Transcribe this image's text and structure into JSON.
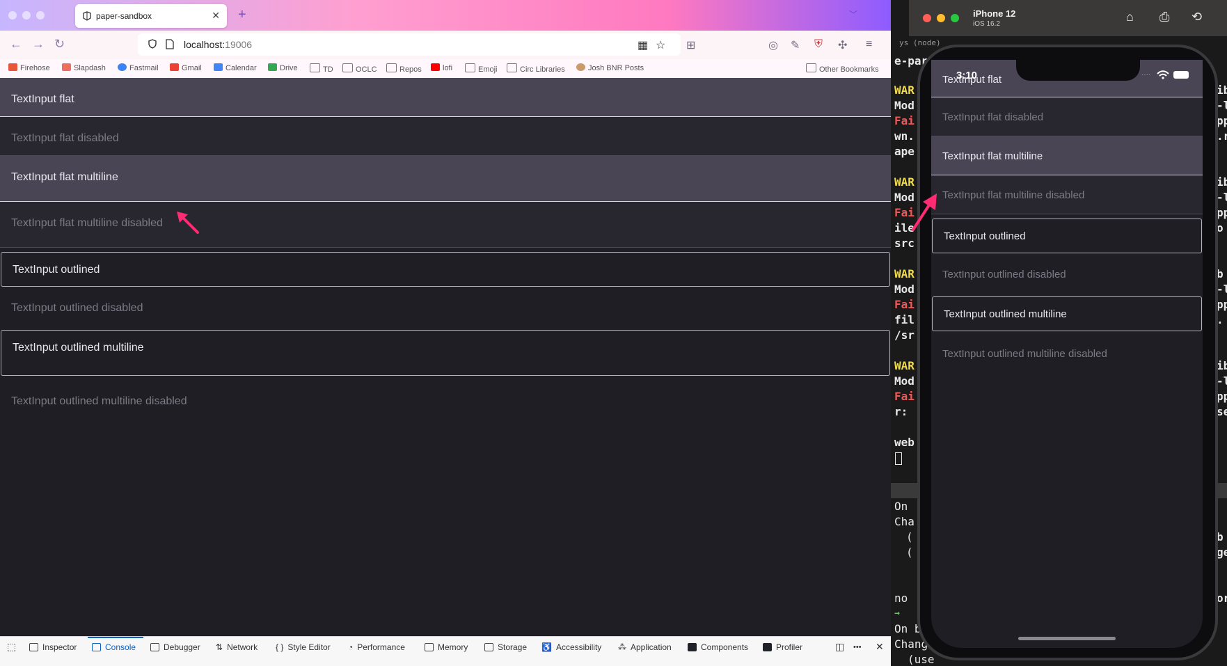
{
  "browser": {
    "tab_title": "paper-sandbox",
    "tab_close": "✕",
    "new_tab": "+",
    "url_host": "localhost:",
    "url_port": "19006",
    "bookmarks": [
      {
        "label": "Firehose",
        "color": "#e8563c"
      },
      {
        "label": "Slapdash",
        "color": "#ee6e5d"
      },
      {
        "label": "Fastmail",
        "color": "#3b83f6"
      },
      {
        "label": "Gmail",
        "color": "#ea4335"
      },
      {
        "label": "Calendar",
        "color": "#4285f4"
      },
      {
        "label": "Drive",
        "color": "#34a853"
      },
      {
        "label": "TD",
        "color": "folder"
      },
      {
        "label": "OCLC",
        "color": "folder"
      },
      {
        "label": "Repos",
        "color": "folder"
      },
      {
        "label": "lofi",
        "color": "#ff0000"
      },
      {
        "label": "Emoji",
        "color": "folder"
      },
      {
        "label": "Circ Libraries",
        "color": "folder"
      },
      {
        "label": "Josh BNR Posts",
        "color": "#c99a6a"
      }
    ],
    "other_bookmarks": "Other Bookmarks"
  },
  "web_inputs": [
    {
      "label": "TextInput flat",
      "variant": "flat",
      "disabled": false
    },
    {
      "label": "TextInput flat disabled",
      "variant": "flat",
      "disabled": true
    },
    {
      "label": "TextInput flat multiline",
      "variant": "flat",
      "disabled": false
    },
    {
      "label": "TextInput flat multiline disabled",
      "variant": "flat",
      "disabled": true
    },
    {
      "label": "TextInput outlined",
      "variant": "outlined",
      "disabled": false
    },
    {
      "label": "TextInput outlined disabled",
      "variant": "outlined",
      "disabled": true
    },
    {
      "label": "TextInput outlined multiline",
      "variant": "outlined",
      "disabled": false
    },
    {
      "label": "TextInput outlined multiline disabled",
      "variant": "outlined",
      "disabled": true
    }
  ],
  "devtools": {
    "tabs": [
      "Inspector",
      "Console",
      "Debugger",
      "Network",
      "Style Editor",
      "Performance",
      "Memory",
      "Storage",
      "Accessibility",
      "Application",
      "Components",
      "Profiler"
    ],
    "active_tab": "Console",
    "more": "•••",
    "close": "✕"
  },
  "simulator": {
    "title": "iPhone 12",
    "subtitle": "iOS 16.2",
    "status_time": "3:10"
  },
  "phone_inputs": [
    {
      "label": "TextInput flat",
      "variant": "flat",
      "disabled": false
    },
    {
      "label": "TextInput flat disabled",
      "variant": "flat",
      "disabled": true
    },
    {
      "label": "TextInput flat multiline",
      "variant": "flat",
      "disabled": false
    },
    {
      "label": "TextInput flat multiline disabled",
      "variant": "flat",
      "disabled": true
    },
    {
      "label": "TextInput outlined",
      "variant": "outlined",
      "disabled": false
    },
    {
      "label": "TextInput outlined disabled",
      "variant": "outlined",
      "disabled": true
    },
    {
      "label": "TextInput outlined multiline",
      "variant": "outlined",
      "disabled": false
    },
    {
      "label": "TextInput outlined multiline disabled",
      "variant": "outlined",
      "disabled": true
    }
  ],
  "terminal": {
    "top_label": "ys (node)",
    "lines": [
      "e-par",
      "WAR",
      "Mod",
      "Fai",
      "wn.",
      "ape",
      "WAR",
      "Mod",
      "Fai",
      "ile",
      "src",
      "WAR",
      "Mod",
      "Fai",
      "fil",
      "/sr",
      "WAR",
      "Mod",
      "Fai",
      "r: ",
      "web",
      "On ",
      "Cha",
      "(",
      "(",
      "no",
      "→",
      "On b",
      "Chang",
      "(use "
    ],
    "right_lines": [
      "ib",
      "-l",
      "pp",
      ".r",
      "ib",
      "-l",
      "pp",
      "o",
      "b",
      "-l",
      "pp",
      ".",
      "ib",
      "-l",
      "pp",
      "se",
      "b",
      "ge",
      "or"
    ]
  },
  "colors": {
    "flat_enabled_bg": "#4a4554",
    "disabled_bg": "#28262e",
    "page_bg": "#1f1e25",
    "annotation_arrow": "#ff2b73"
  }
}
